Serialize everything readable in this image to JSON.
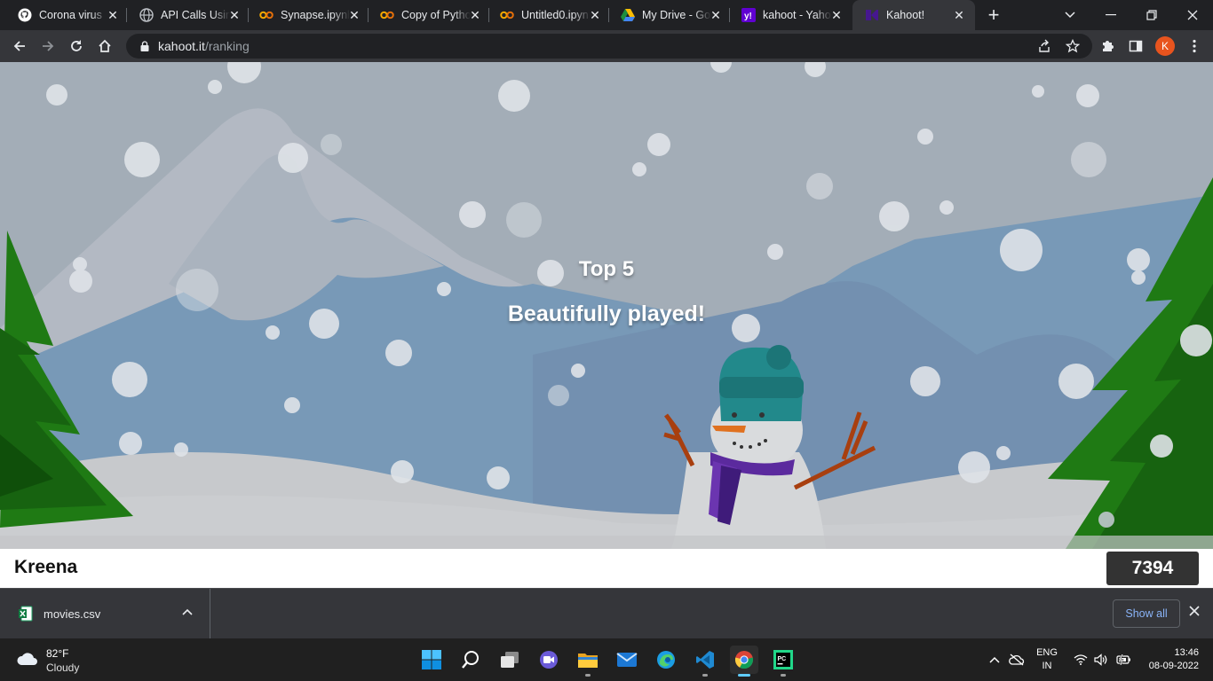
{
  "browser": {
    "tabs": [
      {
        "title": "Corona virus",
        "icon": "github-icon"
      },
      {
        "title": "API Calls Usin",
        "icon": "globe-icon"
      },
      {
        "title": "Synapse.ipynb",
        "icon": "colab-icon"
      },
      {
        "title": "Copy of Pytho",
        "icon": "colab-icon"
      },
      {
        "title": "Untitled0.ipyn",
        "icon": "colab-icon"
      },
      {
        "title": "My Drive - Go",
        "icon": "google-drive-icon"
      },
      {
        "title": "kahoot - Yaho",
        "icon": "yahoo-icon"
      },
      {
        "title": "Kahoot!",
        "icon": "kahoot-icon",
        "active": true
      }
    ],
    "address": {
      "host": "kahoot.it",
      "path": "/ranking"
    },
    "profile_initial": "K",
    "accent": "#e8541e"
  },
  "page": {
    "heading": "Top 5",
    "subheading": "Beautifully played!",
    "player_name": "Kreena",
    "player_score": "7394"
  },
  "downloads": {
    "file_name": "movies.csv",
    "show_all": "Show all"
  },
  "taskbar": {
    "weather_temp": "82°F",
    "weather_desc": "Cloudy",
    "lang_line1": "ENG",
    "lang_line2": "IN",
    "time": "13:46",
    "date": "08-09-2022",
    "apps": [
      "start-icon",
      "search-icon",
      "task-view-icon",
      "teams-chat-icon",
      "file-explorer-icon",
      "mail-icon",
      "edge-icon",
      "vscode-icon",
      "chrome-icon",
      "pycharm-icon"
    ]
  }
}
